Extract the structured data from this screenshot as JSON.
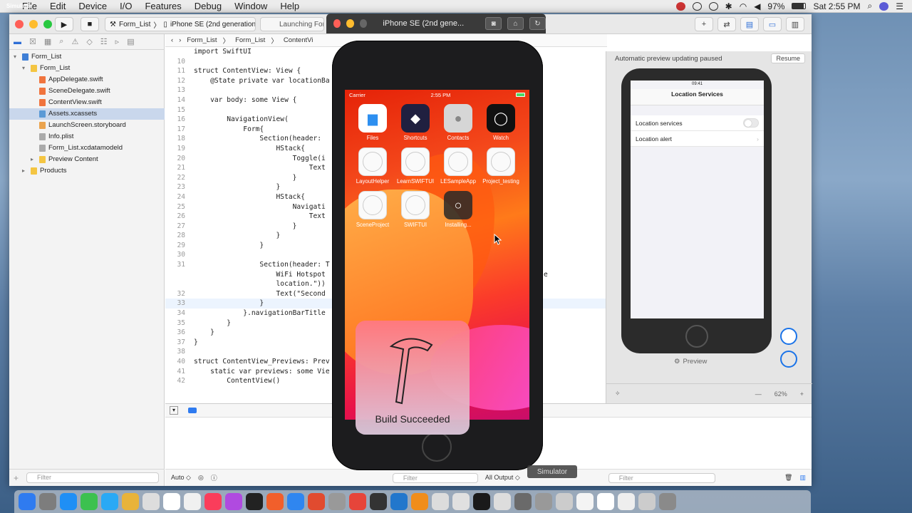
{
  "menubar": {
    "app_name": "Simulator",
    "items": [
      "File",
      "Edit",
      "Device",
      "I/O",
      "Features",
      "Debug",
      "Window",
      "Help"
    ],
    "battery": "97%",
    "clock": "Sat 2:55 PM"
  },
  "xcode": {
    "scheme": "Form_List",
    "destination": "iPhone SE (2nd generation)",
    "activity": "Launching Form_List",
    "navigator": [
      {
        "label": "Form_List",
        "icon": "proj",
        "indent": 0,
        "disclosure": "▾"
      },
      {
        "label": "Form_List",
        "icon": "folder",
        "indent": 1,
        "disclosure": "▾"
      },
      {
        "label": "AppDelegate.swift",
        "icon": "swift",
        "indent": 2,
        "disclosure": ""
      },
      {
        "label": "SceneDelegate.swift",
        "icon": "swift",
        "indent": 2,
        "disclosure": ""
      },
      {
        "label": "ContentView.swift",
        "icon": "swift",
        "indent": 2,
        "disclosure": ""
      },
      {
        "label": "Assets.xcassets",
        "icon": "assets",
        "indent": 2,
        "disclosure": "",
        "selected": true
      },
      {
        "label": "LaunchScreen.storyboard",
        "icon": "sb",
        "indent": 2,
        "disclosure": ""
      },
      {
        "label": "Info.plist",
        "icon": "plist",
        "indent": 2,
        "disclosure": ""
      },
      {
        "label": "Form_List.xcdatamodeld",
        "icon": "plist",
        "indent": 2,
        "disclosure": ""
      },
      {
        "label": "Preview Content",
        "icon": "folder",
        "indent": 2,
        "disclosure": "▸"
      },
      {
        "label": "Products",
        "icon": "folder",
        "indent": 1,
        "disclosure": "▸"
      }
    ],
    "filter_placeholder": "Filter",
    "jumpbar": [
      "Form_List",
      "Form_List",
      "ContentVi"
    ],
    "code_lines": [
      {
        "n": "",
        "t": "import SwiftUI"
      },
      {
        "n": "10",
        "t": ""
      },
      {
        "n": "11",
        "t": "struct ContentView: View {"
      },
      {
        "n": "12",
        "t": "    @State private var locationBa"
      },
      {
        "n": "13",
        "t": ""
      },
      {
        "n": "14",
        "t": "    var body: some View {"
      },
      {
        "n": "15",
        "t": ""
      },
      {
        "n": "16",
        "t": "        NavigationView("
      },
      {
        "n": "17",
        "t": "            Form{"
      },
      {
        "n": "18",
        "t": "                Section(header: "
      },
      {
        "n": "19",
        "t": "                    HStack{"
      },
      {
        "n": "20",
        "t": "                        Toggle(i"
      },
      {
        "n": "21",
        "t": "                            Text"
      },
      {
        "n": "22",
        "t": "                        }"
      },
      {
        "n": "23",
        "t": "                    }"
      },
      {
        "n": "24",
        "t": "                    HStack{"
      },
      {
        "n": "25",
        "t": "                        Navigati"
      },
      {
        "n": "26",
        "t": "                            Text"
      },
      {
        "n": "27",
        "t": "                        }"
      },
      {
        "n": "28",
        "t": "                    }"
      },
      {
        "n": "29",
        "t": "                }"
      },
      {
        "n": "30",
        "t": ""
      },
      {
        "n": "31",
        "t": "                Section(header: T                                       owd sourced"
      },
      {
        "n": "",
        "t": "                    WiFi Hotspot                                           approximate"
      },
      {
        "n": "",
        "t": "                    location.\"))"
      },
      {
        "n": "32",
        "t": "                    Text(\"Second"
      },
      {
        "n": "33",
        "t": "                }",
        "current": true
      },
      {
        "n": "34",
        "t": "            }.navigationBarTitle"
      },
      {
        "n": "35",
        "t": "        }"
      },
      {
        "n": "36",
        "t": "    }"
      },
      {
        "n": "37",
        "t": "}"
      },
      {
        "n": "38",
        "t": ""
      },
      {
        "n": "40",
        "t": "struct ContentView_Previews: Prev"
      },
      {
        "n": "41",
        "t": "    static var previews: some Vie"
      },
      {
        "n": "42",
        "t": "        ContentView()"
      }
    ],
    "bottom": {
      "auto": "Auto ◇",
      "filter": "Filter",
      "output": "All Output ◇",
      "filter2": "Filter"
    },
    "canvas": {
      "status": "Automatic preview updating paused",
      "resume": "Resume",
      "time": "09:41",
      "nav_title": "Location Services",
      "rows": [
        "Location services",
        "Location alert"
      ],
      "caption": "Preview",
      "zoom": "62%"
    }
  },
  "simulator": {
    "title": "iPhone SE (2nd gene...",
    "carrier": "Carrier",
    "time": "2:55 PM",
    "apps": [
      {
        "label": "Files",
        "kind": "files",
        "glyph": "▆"
      },
      {
        "label": "Shortcuts",
        "kind": "shortcuts",
        "glyph": "◆"
      },
      {
        "label": "Contacts",
        "kind": "contacts",
        "glyph": "●"
      },
      {
        "label": "Watch",
        "kind": "watch",
        "glyph": "◯"
      },
      {
        "label": "LayoutHelper",
        "kind": "blank",
        "glyph": ""
      },
      {
        "label": "LearnSWIFTUI",
        "kind": "blank",
        "glyph": ""
      },
      {
        "label": "LESampleApp",
        "kind": "blank",
        "glyph": ""
      },
      {
        "label": "Project_testing",
        "kind": "blank",
        "glyph": ""
      },
      {
        "label": "SceneProject",
        "kind": "blank",
        "glyph": ""
      },
      {
        "label": "SWIFTUI",
        "kind": "blank",
        "glyph": ""
      },
      {
        "label": "Installing...",
        "kind": "install",
        "glyph": "○"
      }
    ],
    "toast": "Build Succeeded",
    "tooltip": "Simulator"
  },
  "dock_colors": [
    "#2f7bf0",
    "#7d7d7d",
    "#1f8ff5",
    "#3cc14f",
    "#2aa9f5",
    "#e8b33a",
    "#dddddd",
    "#ffffff",
    "#f0f0f0",
    "#fa3d5b",
    "#b04ae0",
    "#222222",
    "#f15f2b",
    "#2f86f0",
    "#e14b2f",
    "#999999",
    "#e6453a",
    "#333333",
    "#2277cc",
    "#f08d1a",
    "#dcdcdc",
    "#e0e0e0",
    "#1a1a1a",
    "#ddd",
    "#6a6a6a",
    "#999",
    "#cccccc",
    "#f4f4f4",
    "#ffffff",
    "#eeeeee",
    "#cccccc",
    "#8a8a8a"
  ]
}
